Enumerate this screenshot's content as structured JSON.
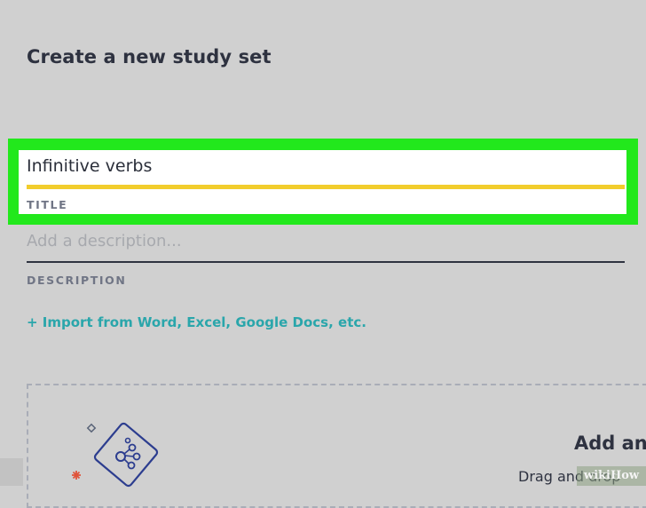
{
  "page": {
    "title": "Create a new study set"
  },
  "title_field": {
    "value": "Infinitive verbs",
    "label": "TITLE"
  },
  "description_field": {
    "placeholder": "Add a description...",
    "label": "DESCRIPTION"
  },
  "import_link": {
    "label": "+ Import from Word, Excel, Google Docs, etc."
  },
  "dropzone": {
    "heading": "Add and",
    "subtext": "Drag and drop"
  },
  "watermark": {
    "text": "wikiHow"
  },
  "colors": {
    "highlight": "#22e81c",
    "title_underline": "#f2cd2c",
    "link": "#2aa6ab",
    "illustration_stroke": "#2c3d8f",
    "accent_star": "#e0533a"
  },
  "icons": {
    "illustration": "diagram-card-icon",
    "star": "asterisk-icon",
    "sparkle": "diamond-icon"
  }
}
